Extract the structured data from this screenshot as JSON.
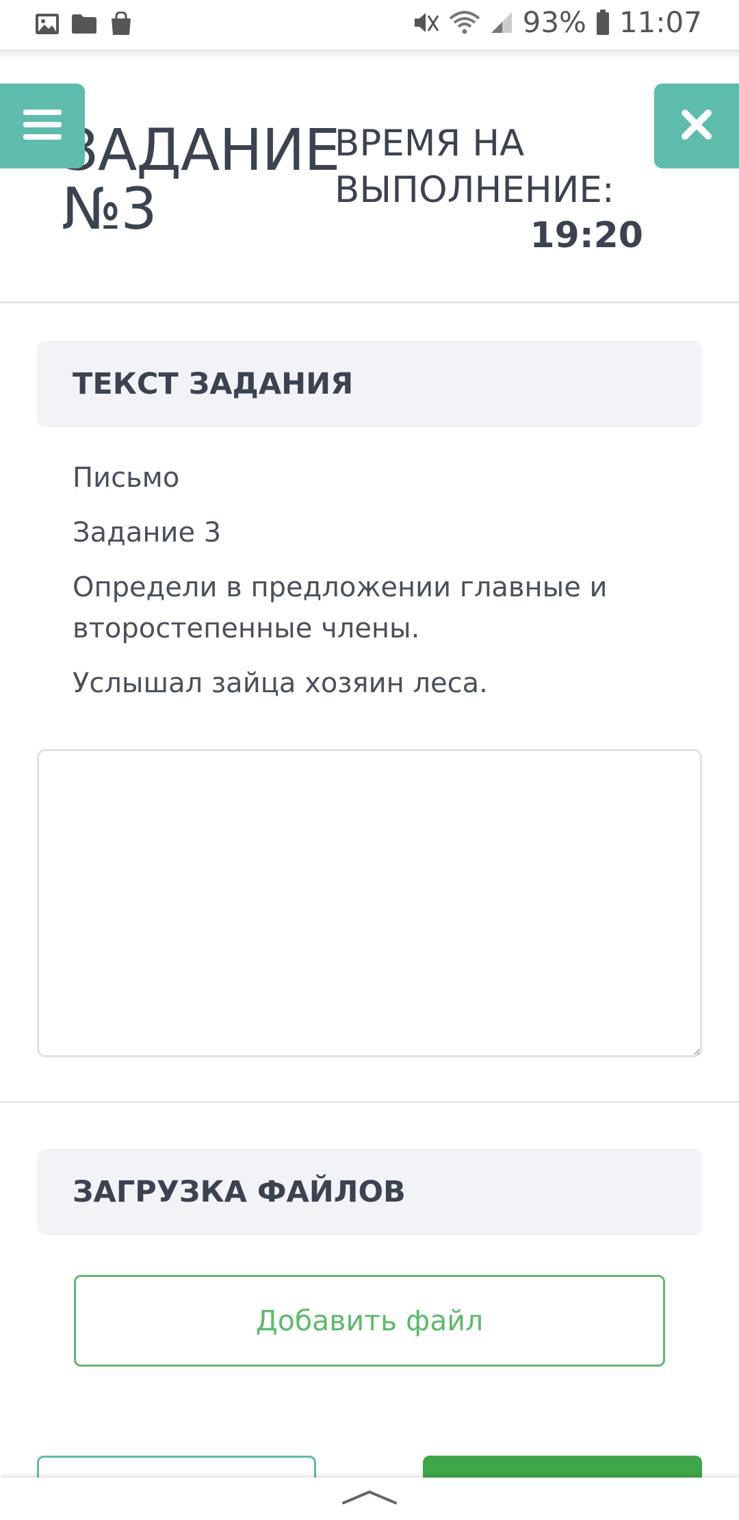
{
  "status_bar": {
    "icons_left": [
      "image-icon",
      "folder-icon",
      "shopping-bag-icon"
    ],
    "icons_right": [
      "mute-icon",
      "wifi-icon",
      "signal-icon",
      "battery-icon"
    ],
    "battery": "93%",
    "time": "11:07"
  },
  "header": {
    "title_line1": "ЗАДАНИЕ",
    "title_line2": "№3",
    "time_label": "ВРЕМЯ НА ВЫПОЛНЕНИЕ:",
    "time_value": "19:20"
  },
  "task": {
    "section_title": "ТЕКСТ ЗАДАНИЯ",
    "paragraphs": [
      "Письмо",
      "Задание 3",
      "Определи в предложении главные и второстепенные члены.",
      "Услышал зайца хозяин леса."
    ]
  },
  "answer": {
    "value": ""
  },
  "files": {
    "section_title": "ЗАГРУЗКА ФАЙЛОВ",
    "add_button_label": "Добавить файл"
  },
  "colors": {
    "accent_teal": "#5ebcad",
    "accent_green": "#5cba6c",
    "submit_green": "#3fa748",
    "section_bg": "#f2f3f7",
    "text": "#3c4350"
  }
}
